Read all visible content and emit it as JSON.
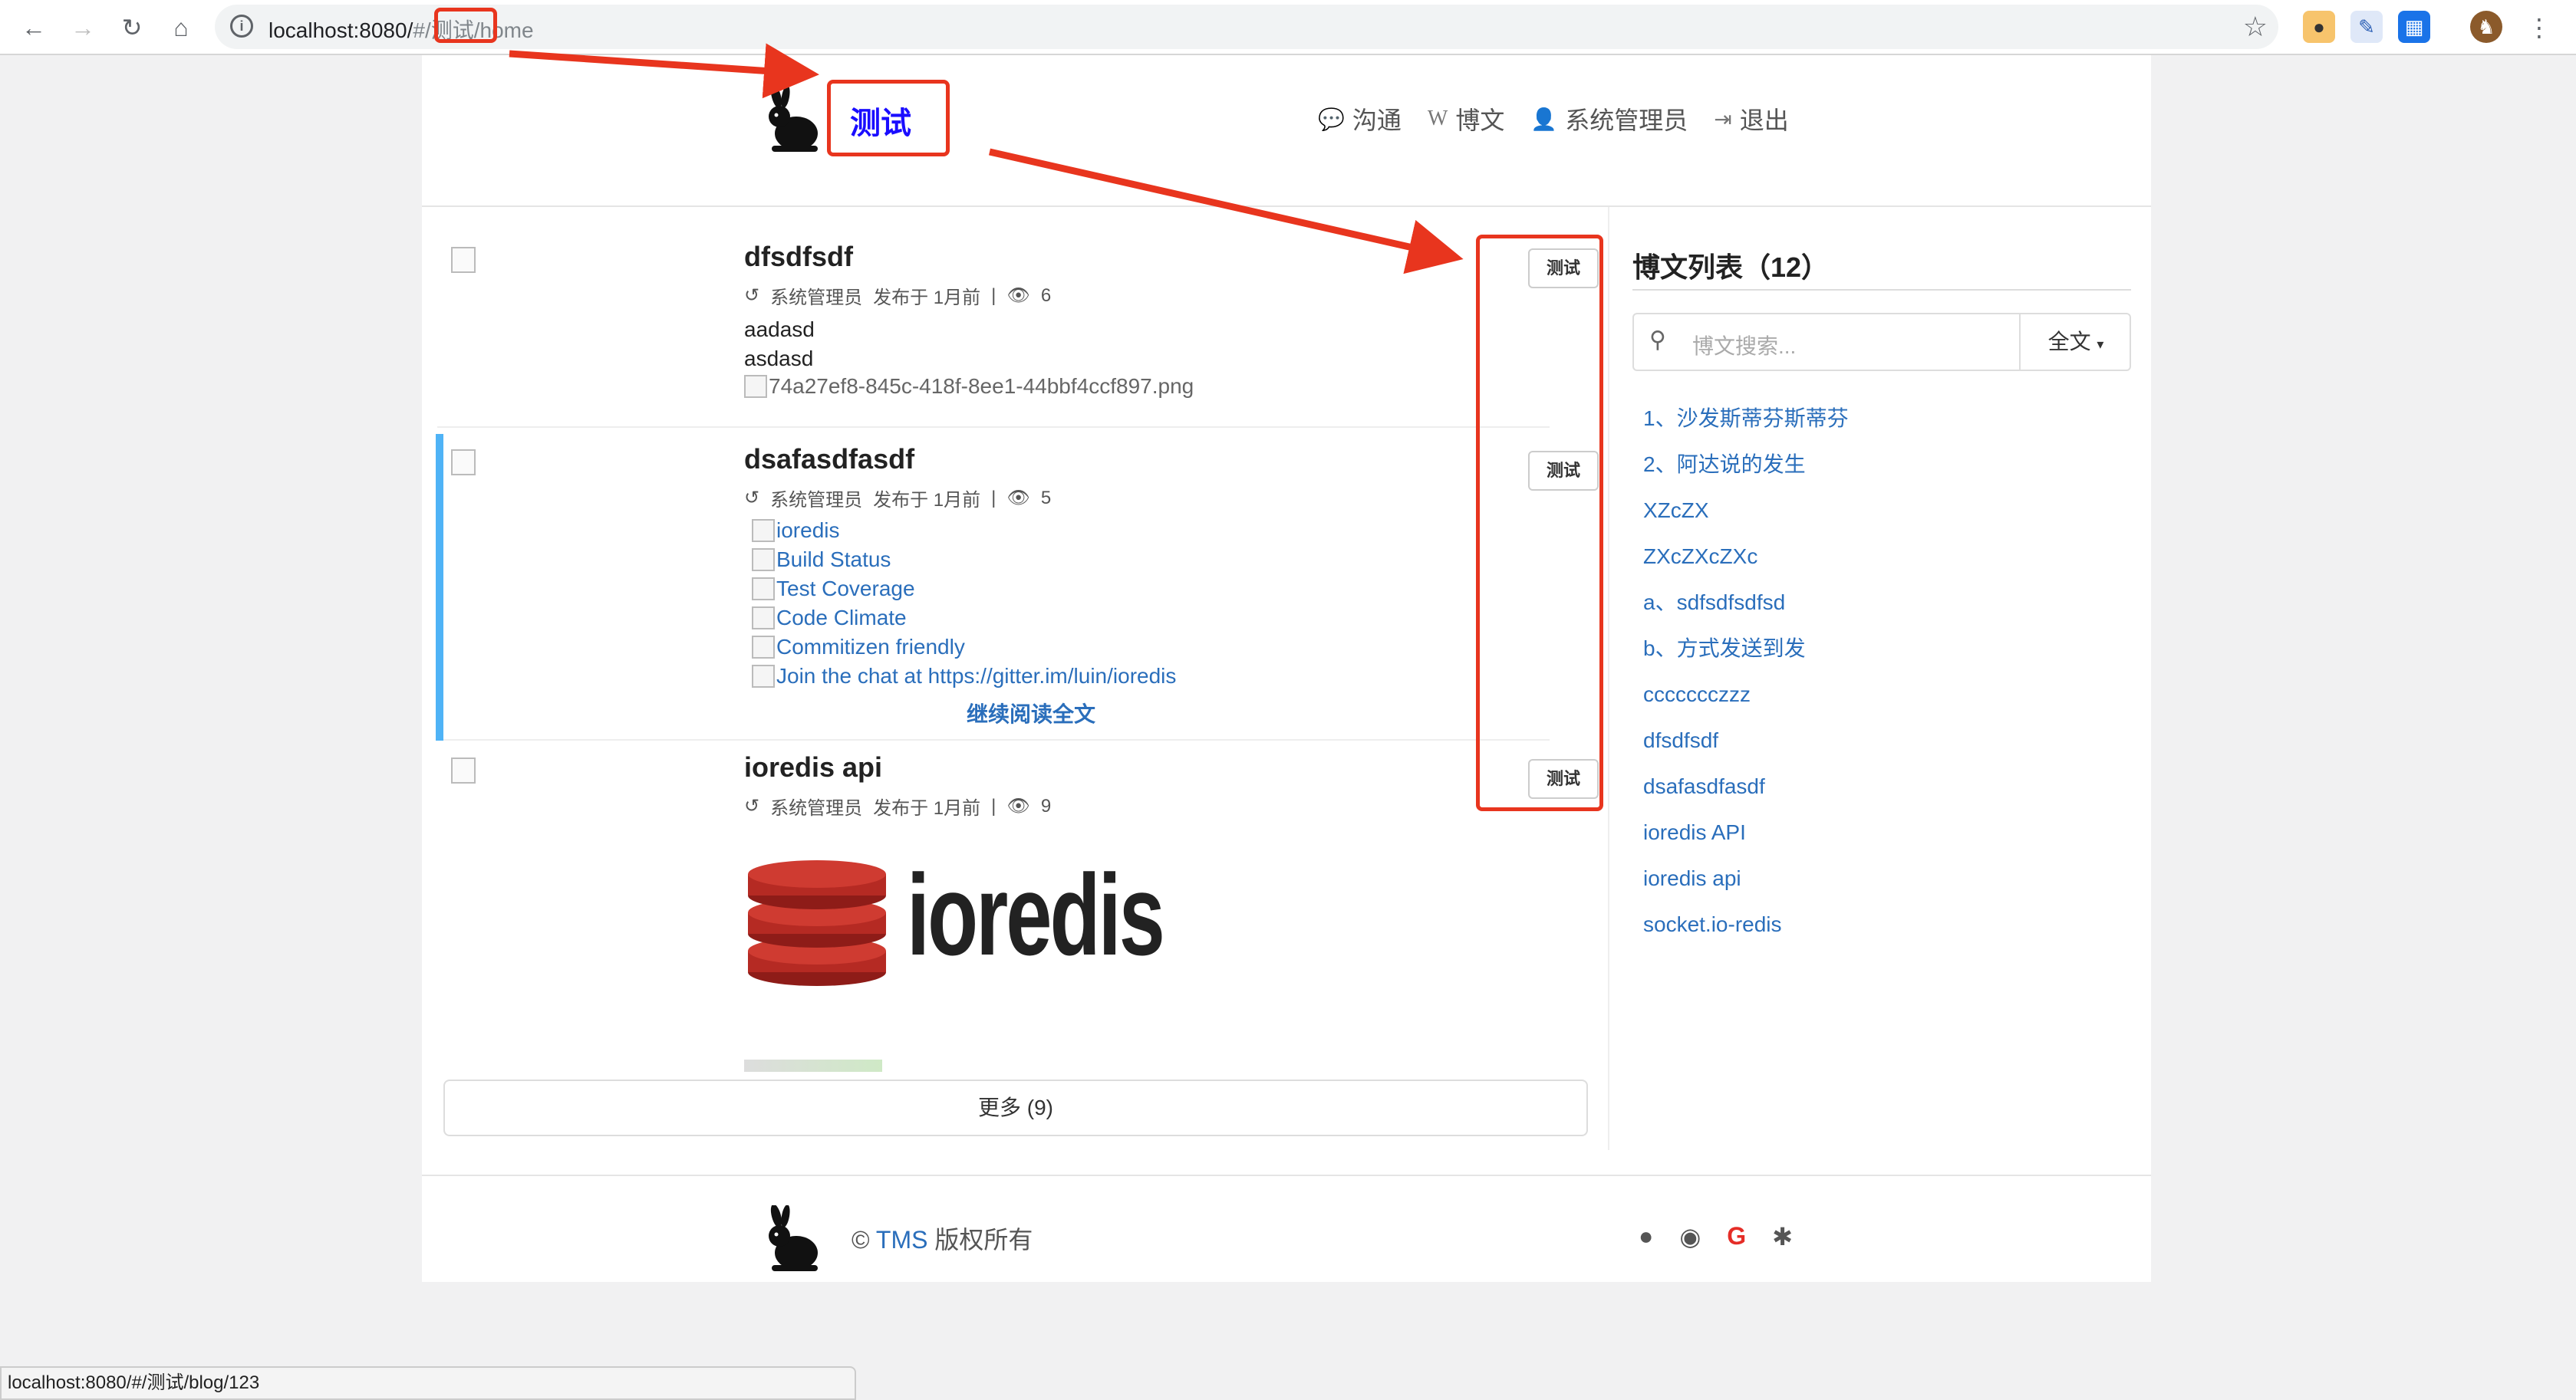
{
  "browser": {
    "url_host": "localhost:8080/",
    "url_hash": "#",
    "url_seg": "/测试/",
    "url_tail": "home"
  },
  "header": {
    "brand": "测试",
    "nav": [
      {
        "label": "沟通",
        "icon": "chat-icon"
      },
      {
        "label": "博文",
        "icon": "wikipedia-icon"
      },
      {
        "label": "系统管理员",
        "icon": "user-icon"
      },
      {
        "label": "退出",
        "icon": "logout-icon"
      }
    ]
  },
  "articles": [
    {
      "title": "dfsdfsdf",
      "author": "系统管理员",
      "published": "发布于 1月前",
      "views": "6",
      "tag": "测试",
      "lines": [
        "aadasd",
        "asdasd"
      ],
      "image_alt": "74a27ef8-845c-418f-8ee1-44bbf4ccf897.png"
    },
    {
      "title": "dsafasdfasdf",
      "author": "系统管理员",
      "published": "发布于 1月前",
      "views": "5",
      "tag": "测试",
      "badges": [
        "ioredis",
        "Build Status",
        "Test Coverage",
        "Code Climate",
        "Commitizen friendly",
        "Join the chat at https://gitter.im/luin/ioredis"
      ],
      "read_more": "继续阅读全文"
    },
    {
      "title": "ioredis api",
      "author": "系统管理员",
      "published": "发布于 1月前",
      "views": "9",
      "tag": "测试",
      "logo_text": "ioredis"
    }
  ],
  "more_button": "更多 (9)",
  "sidebar": {
    "title": "博文列表（12）",
    "search_placeholder": "博文搜索...",
    "search_scope": "全文",
    "items": [
      "1、沙发斯蒂芬斯蒂芬",
      "2、阿达说的发生",
      "XZcZX",
      "ZXcZXcZXc",
      "a、sdfsdfsdfsd",
      "b、方式发送到发",
      "ccccccczzz",
      "dfsdfsdf",
      "dsafasdfasdf",
      "ioredis API",
      "ioredis api",
      "socket.io-redis"
    ]
  },
  "footer": {
    "copyright_symbol": "©",
    "brand": "TMS",
    "text": "版权所有"
  },
  "status_url": "localhost:8080/#/测试/blog/123",
  "colors": {
    "accent": "#2a6ebb",
    "annotation": "#e8351e",
    "brand": "#1a0dff",
    "left_bar": "#4fb3f6"
  }
}
